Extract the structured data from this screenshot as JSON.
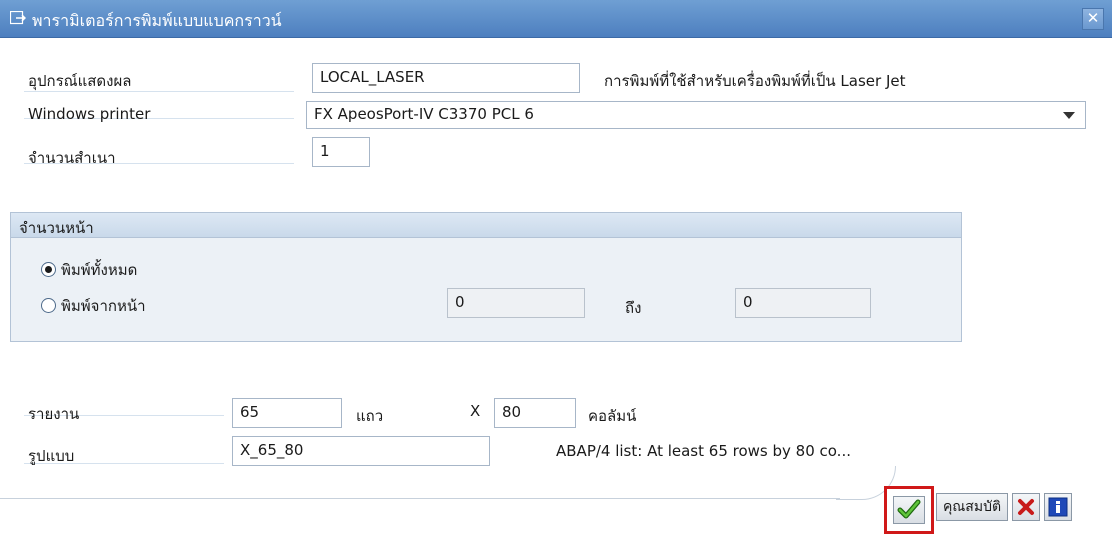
{
  "window": {
    "title": "พารามิเตอร์การพิมพ์แบบแบคกราวน์",
    "close_icon": "close-icon",
    "title_icon": "dialog-icon"
  },
  "printer": {
    "output_device_label": "อุปกรณ์แสดงผล",
    "output_device_value": "LOCAL_LASER",
    "output_device_desc": "การพิมพ์ที่ใช้สำหรับเครื่องพิมพ์ที่เป็น Laser Jet",
    "windows_printer_label": "Windows printer",
    "windows_printer_value": "FX ApeosPort-IV C3370 PCL 6",
    "copies_label": "จำนวนสำเนา",
    "copies_value": "1"
  },
  "pages": {
    "group_title": "จำนวนหน้า",
    "print_all_label": "พิมพ์ทั้งหมด",
    "print_all_selected": true,
    "print_from_label": "พิมพ์จากหน้า",
    "print_from_selected": false,
    "from_value": "0",
    "to_label": "ถึง",
    "to_value": "0"
  },
  "report": {
    "report_label": "รายงาน",
    "rows_value": "65",
    "rows_unit": "แถว",
    "x_label": "X",
    "cols_value": "80",
    "cols_unit": "คอลัมน์",
    "format_label": "รูปแบบ",
    "format_value": "X_65_80",
    "format_desc": "ABAP/4 list: At least 65 rows by 80 co..."
  },
  "buttons": {
    "confirm_icon": "checkmark-icon",
    "properties_label": "คุณสมบัติ",
    "cancel_icon": "cancel-x-icon",
    "info_icon": "info-icon"
  },
  "colors": {
    "titlebar": "#5a8bc8",
    "highlight": "#d01818",
    "group_bg": "#ecf1f6"
  }
}
